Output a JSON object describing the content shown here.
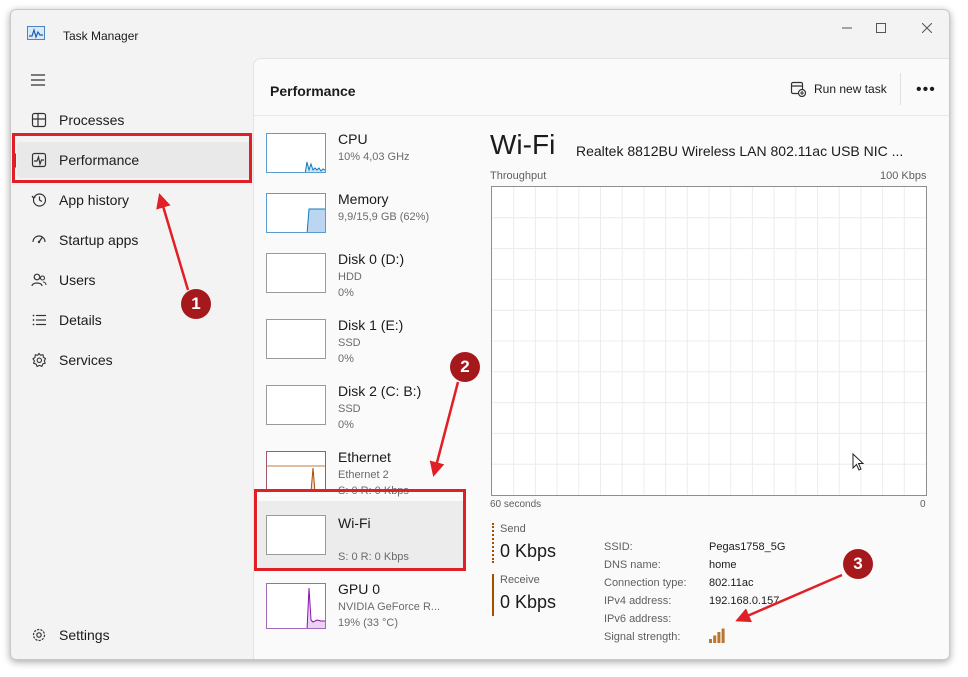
{
  "window": {
    "title": "Task Manager",
    "minimize": "—",
    "maximize": "☐",
    "close": "✕"
  },
  "sidebar": {
    "items": [
      {
        "label": "Processes",
        "icon": "processes-icon"
      },
      {
        "label": "Performance",
        "icon": "performance-icon",
        "active": true
      },
      {
        "label": "App history",
        "icon": "history-icon"
      },
      {
        "label": "Startup apps",
        "icon": "startup-icon"
      },
      {
        "label": "Users",
        "icon": "users-icon"
      },
      {
        "label": "Details",
        "icon": "details-icon"
      },
      {
        "label": "Services",
        "icon": "services-icon"
      }
    ],
    "settings_label": "Settings"
  },
  "header": {
    "title": "Performance",
    "run_new_task": "Run new task",
    "more": "•••"
  },
  "devices": [
    {
      "name": "CPU",
      "line1": "10% 4,03 GHz",
      "line2": ""
    },
    {
      "name": "Memory",
      "line1": "9,9/15,9 GB (62%)",
      "line2": ""
    },
    {
      "name": "Disk 0 (D:)",
      "line1": "HDD",
      "line2": "0%"
    },
    {
      "name": "Disk 1 (E:)",
      "line1": "SSD",
      "line2": "0%"
    },
    {
      "name": "Disk 2 (C: B:)",
      "line1": "SSD",
      "line2": "0%"
    },
    {
      "name": "Ethernet",
      "line1": "Ethernet 2",
      "line2": "S: 0 R: 0 Kbps"
    },
    {
      "name": "Wi-Fi",
      "line1": "",
      "line2": "S: 0 R: 0 Kbps",
      "selected": true
    },
    {
      "name": "GPU 0",
      "line1": "NVIDIA GeForce R...",
      "line2": "19% (33 °C)"
    }
  ],
  "detail": {
    "title": "Wi-Fi",
    "adapter": "Realtek 8812BU Wireless LAN 802.11ac USB NIC ...",
    "throughput_label": "Throughput",
    "max_label": "100 Kbps",
    "x_left": "60 seconds",
    "x_right": "0",
    "send_label": "Send",
    "send_value": "0 Kbps",
    "receive_label": "Receive",
    "receive_value": "0 Kbps",
    "info": [
      {
        "key": "SSID:",
        "value": "Pegas1758_5G"
      },
      {
        "key": "DNS name:",
        "value": "home"
      },
      {
        "key": "Connection type:",
        "value": "802.11ac"
      },
      {
        "key": "IPv4 address:",
        "value": "192.168.0.157"
      },
      {
        "key": "IPv6 address:",
        "value": ""
      },
      {
        "key": "Signal strength:",
        "value": ""
      }
    ],
    "signal_bars_filled": 4,
    "signal_bars_total": 4
  },
  "annotations": {
    "badge1": "1",
    "badge2": "2",
    "badge3": "3"
  },
  "colors": {
    "accent": "#1b5fb8",
    "highlight": "#e01f26",
    "badge": "#a5191d",
    "cpu": "#117dbb",
    "memory": "#8b12ae",
    "ethernet": "#a74f01",
    "signal": "#b8762e"
  }
}
